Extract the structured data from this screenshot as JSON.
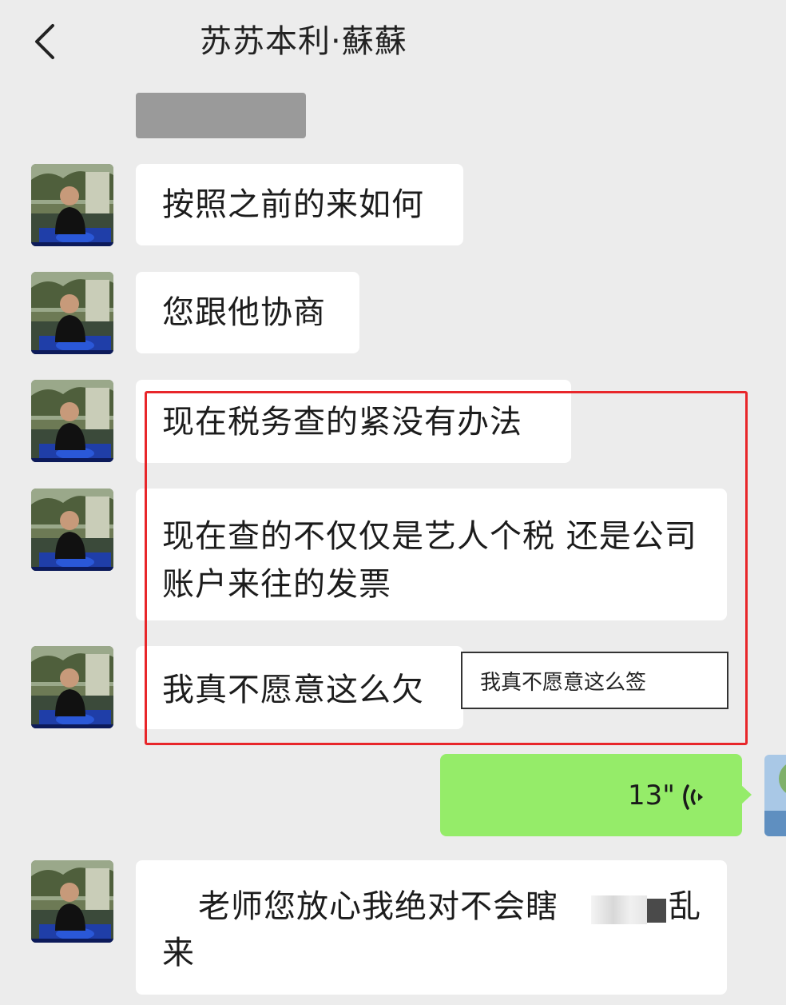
{
  "header": {
    "title": "苏苏本利·蘇蘇"
  },
  "messages": [
    {
      "text": "按照之前的来如何"
    },
    {
      "text": "您跟他协商"
    },
    {
      "text": "现在税务查的紧没有办法"
    },
    {
      "text": "现在查的不仅仅是艺人个税 还是公司账户来往的发票"
    },
    {
      "text": "我真不愿意这么欠"
    }
  ],
  "annotation": {
    "text": "我真不愿意这么签",
    "highlight_color": "#e8262a"
  },
  "voice_message": {
    "duration": "13\"",
    "color": "#95ec69"
  },
  "last_message": {
    "line1_start": "老师您放心我绝对不会瞎",
    "line1_end": "乱",
    "line2": "来"
  },
  "icons": {
    "back": "chevron-left-icon",
    "voice": "voice-wave-icon"
  }
}
